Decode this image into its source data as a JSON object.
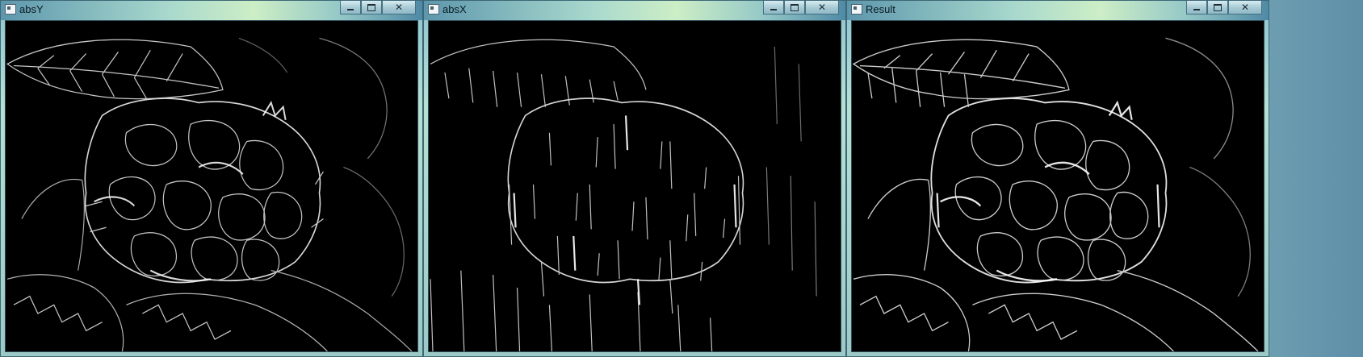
{
  "windows": [
    {
      "title": "absY",
      "controls": {
        "minimize_icon": "minimize-icon",
        "maximize_icon": "maximize-icon",
        "close_icon": "close-icon",
        "close_label": "✕"
      }
    },
    {
      "title": "absX",
      "controls": {
        "minimize_icon": "minimize-icon",
        "maximize_icon": "maximize-icon",
        "close_icon": "close-icon",
        "close_label": "✕"
      }
    },
    {
      "title": "Result",
      "controls": {
        "minimize_icon": "minimize-icon",
        "maximize_icon": "maximize-icon",
        "close_icon": "close-icon",
        "close_label": "✕"
      }
    }
  ],
  "colors": {
    "image_background": "#000000",
    "edge_stroke": "#e6e6e6",
    "titlebar_text": "#0b1a22"
  }
}
